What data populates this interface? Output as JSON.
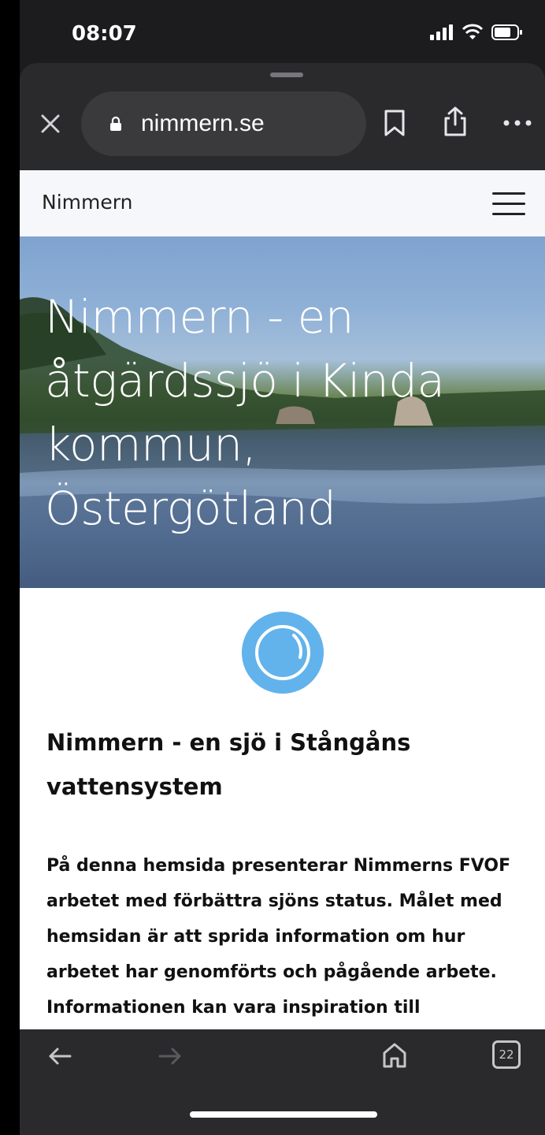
{
  "status_bar": {
    "time": "08:07"
  },
  "browser": {
    "url": "nimmern.se",
    "tab_count": "22"
  },
  "site": {
    "name": "Nimmern",
    "hero_title": "Nimmern - en åtgärdssjö i Kinda kommun, Östergötland",
    "section_title": "Nimmern - en sjö i Stångåns vattensystem",
    "paragraph": "På denna hemsida presenterar Nimmerns FVOF arbetet med förbättra sjöns status. Målet med hemsidan är att sprida information om hur arbetet har genomförts och pågående arbete. Informationen kan vara inspiration till"
  },
  "colors": {
    "logo_circle": "#62b3ec",
    "browser_chrome": "#2a2a2c",
    "header_bg": "#f5f7fa"
  }
}
